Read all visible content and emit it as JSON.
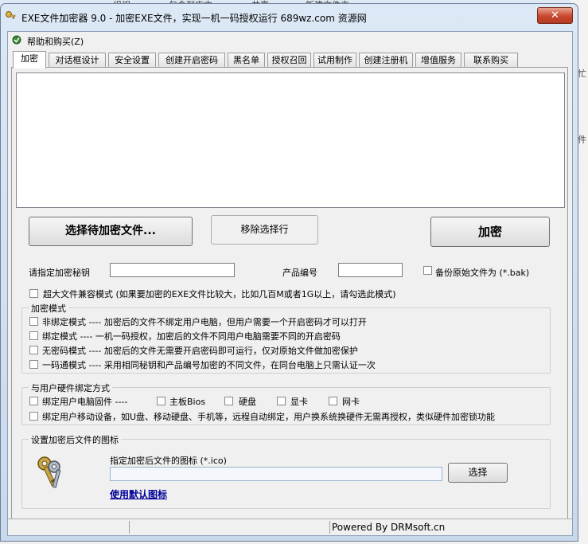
{
  "window": {
    "title": "EXE文件加密器 9.0 - 加密EXE文件，实现一机一码授权运行   689wz.com 资源网",
    "close": "✕"
  },
  "background": {
    "menu_items": [
      "组织 ▾",
      "包含到库中 ▾",
      "共享 ▾",
      "新建文件夹"
    ],
    "right_glyphs": [
      "忙",
      "件"
    ]
  },
  "menu": {
    "help": "帮助和购买(Z)"
  },
  "tabs": [
    "加密",
    "对话框设计",
    "安全设置",
    "创建开启密码",
    "黑名单",
    "授权召回",
    "试用制作",
    "创建注册机",
    "增值服务",
    "联系购买"
  ],
  "buttons": {
    "select_file": "选择待加密文件...",
    "remove_row": "移除选择行",
    "encrypt": "加密",
    "choose_icon": "选择"
  },
  "fields": {
    "key_label": "请指定加密秘钥",
    "key_value": "",
    "product_label": "产品编号",
    "product_value": "",
    "backup_label": "备份原始文件为 (*.bak)"
  },
  "large_file_label": "超大文件兼容模式 (如果要加密的EXE文件比较大，比如几百M或者1G以上，请勾选此模式)",
  "modes": {
    "title": "加密模式",
    "items": [
      "非绑定模式 ---- 加密后的文件不绑定用户电脑，但用户需要一个开启密码才可以打开",
      "绑定模式 ---- 一机一码授权，加密后的文件不同用户电脑需要不同的开启密码",
      "无密码模式 ---- 加密后的文件无需要开启密码即可运行，仅对原始文件做加密保护",
      "一码通模式 ---- 采用相同秘钥和产品编号加密的不同文件，在同台电脑上只需认证一次"
    ]
  },
  "hardware": {
    "title": "与用户硬件绑定方式",
    "bind_firmware": "绑定用户电脑固件 ----",
    "bios": "主板Bios",
    "disk": "硬盘",
    "gpu": "显卡",
    "nic": "网卡",
    "mobile": "绑定用户移动设备，如U盘、移动硬盘、手机等，远程自动绑定，用户换系统换硬件无需再授权，类似硬件加密锁功能"
  },
  "icon_section": {
    "title": "设置加密后文件的图标",
    "prompt": "指定加密后文件的图标 (*.ico)",
    "path": "",
    "default_link": "使用默认图标"
  },
  "status": {
    "powered": "Powered By DRMsoft.cn"
  }
}
